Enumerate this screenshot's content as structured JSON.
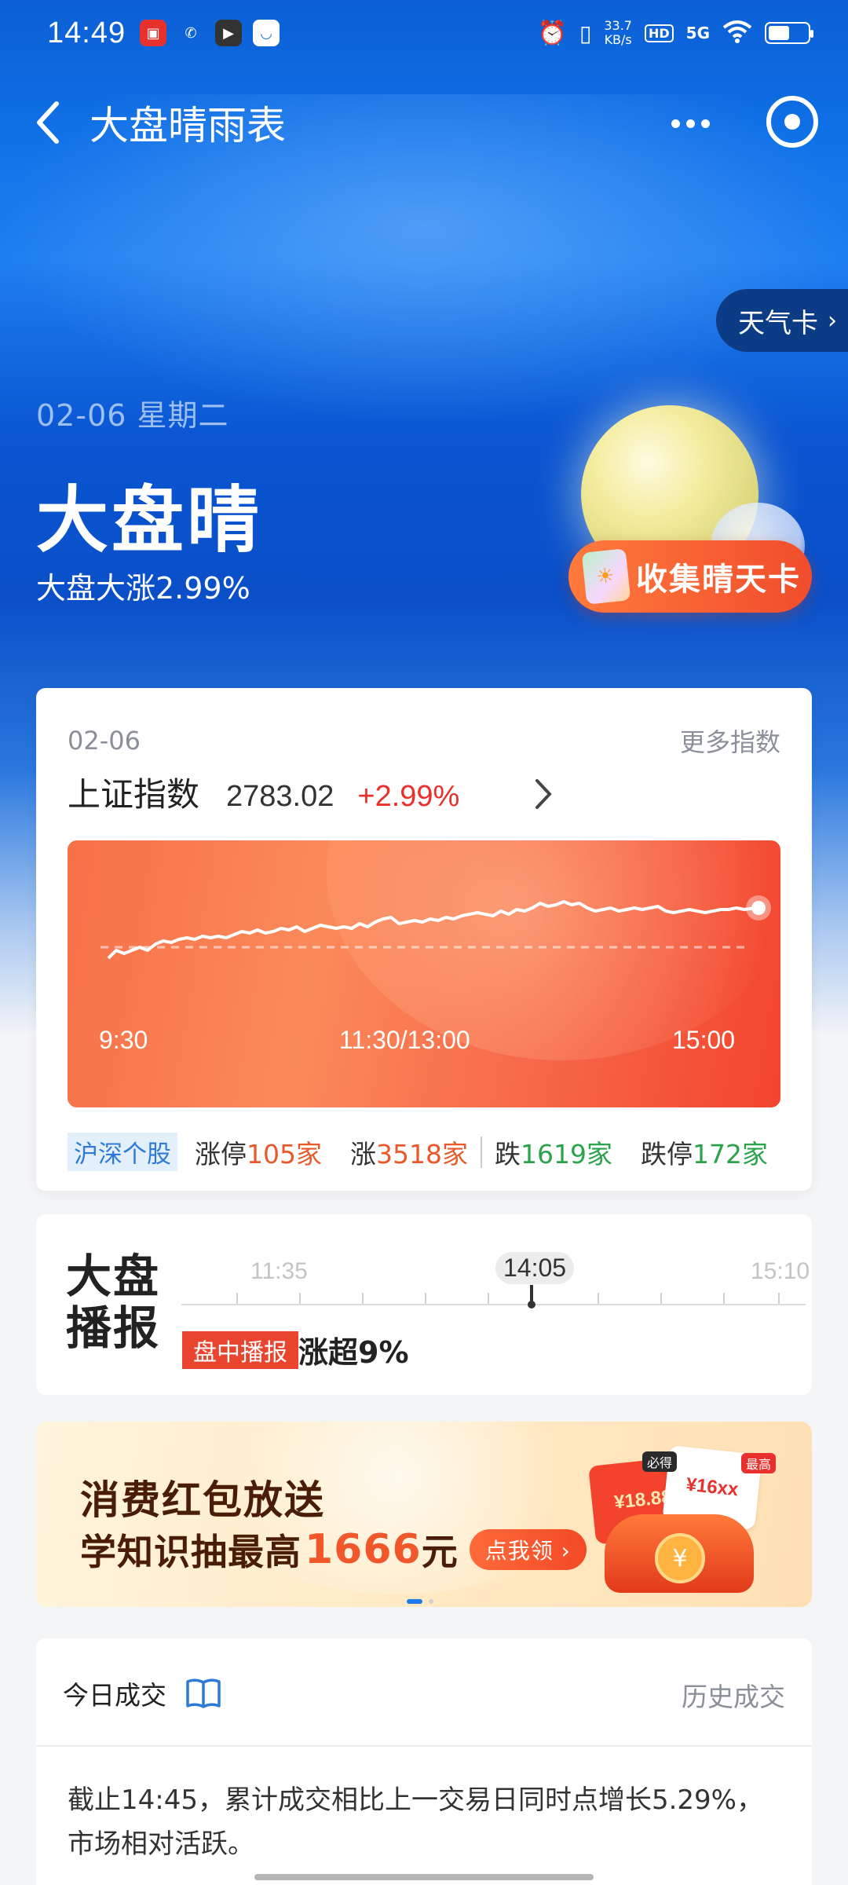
{
  "status_bar": {
    "time": "14:49",
    "speed_value": "33.7",
    "speed_unit": "KB/s",
    "hd": "HD",
    "network": "5G",
    "battery_level": 0.55
  },
  "nav": {
    "title": "大盘晴雨表"
  },
  "weather_card": {
    "label": "天气卡",
    "arrow": "›"
  },
  "hero": {
    "date": "02-06 星期二",
    "title": "大盘晴",
    "subtitle": "大盘大涨2.99%",
    "collect_button": "收集晴天卡"
  },
  "index_card": {
    "date": "02-06",
    "more_label": "更多指数",
    "index_name": "上证指数",
    "index_value": "2783.02",
    "index_change": "+2.99%",
    "colors": {
      "up": "#e8312c",
      "down": "#2aa34a"
    },
    "chart": {
      "ticks": [
        "9:30",
        "11:30/13:00",
        "15:00"
      ]
    },
    "stats": {
      "tag": "沪深个股",
      "limit_up_label": "涨停",
      "limit_up_value": "105",
      "limit_up_unit": "家",
      "up_label": "涨",
      "up_value": "3518",
      "up_unit": "家",
      "down_label": "跌",
      "down_value": "1619",
      "down_unit": "家",
      "limit_down_label": "跌停",
      "limit_down_value": "172",
      "limit_down_unit": "家"
    }
  },
  "broadcast": {
    "title_line1": "大盘",
    "title_line2": "播报",
    "time_left": "11:35",
    "time_now": "14:05",
    "time_right": "15:10",
    "tag": "盘中播报",
    "text": "涨超9%"
  },
  "banner": {
    "line1": "消费红包放送",
    "line2_prefix": "学知识抽最高",
    "line2_amount": "1666",
    "line2_unit": "元",
    "cta": "点我领 ›",
    "packet1": "¥18.88",
    "packet2": "¥16xx",
    "badge1": "必得",
    "badge2": "最高",
    "coin": "¥"
  },
  "volume_card": {
    "title": "今日成交",
    "history": "历史成交",
    "text": "截止14:45，累计成交相比上一交易日同时点增长5.29%，市场相对活跃。"
  }
}
